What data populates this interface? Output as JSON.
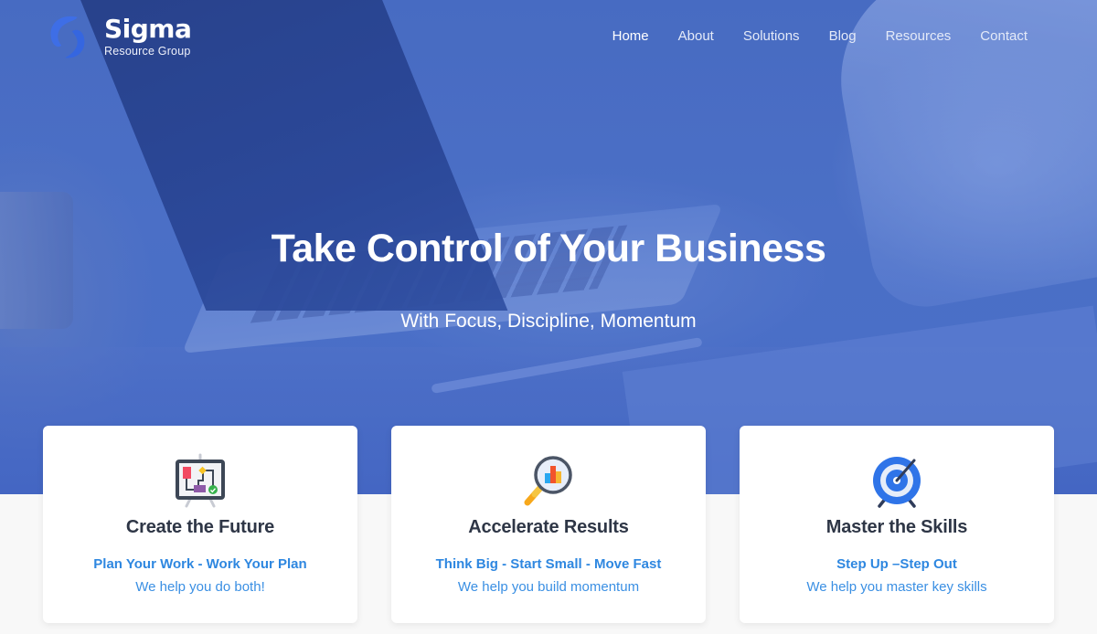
{
  "brand": {
    "name": "Sigma",
    "subtitle": "Resource Group"
  },
  "nav": {
    "items": [
      {
        "label": "Home",
        "active": true
      },
      {
        "label": "About",
        "active": false
      },
      {
        "label": "Solutions",
        "active": false
      },
      {
        "label": "Blog",
        "active": false
      },
      {
        "label": "Resources",
        "active": false
      },
      {
        "label": "Contact",
        "active": false
      }
    ]
  },
  "hero": {
    "title": "Take Control of Your Business",
    "subtitle": "With Focus, Discipline, Momentum"
  },
  "cards": [
    {
      "icon": "presentation-board-icon",
      "title": "Create the Future",
      "tagline": "Plan Your Work - Work Your Plan",
      "description": "We help you do both!"
    },
    {
      "icon": "magnifier-chart-icon",
      "title": "Accelerate Results",
      "tagline": "Think Big - Start Small - Move Fast",
      "description": "We help you build momentum"
    },
    {
      "icon": "target-icon",
      "title": "Master the Skills",
      "tagline": "Step Up –Step Out",
      "description": "We help you master key skills"
    }
  ],
  "colors": {
    "hero_blue": "#4e72c8",
    "accent_blue": "#2e87e0",
    "heading_dark": "#2e3646",
    "page_bg": "#f8f8f8"
  }
}
